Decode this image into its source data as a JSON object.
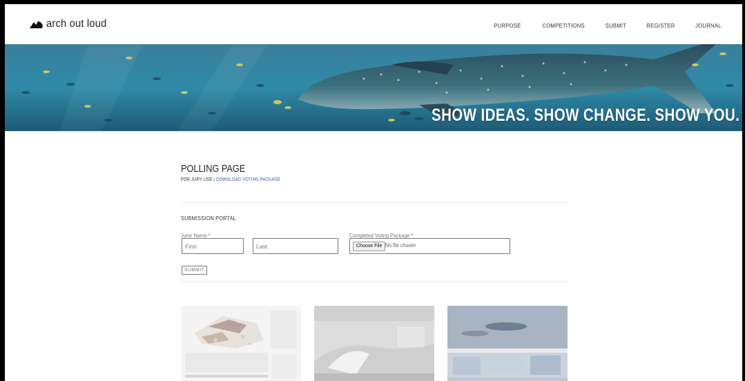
{
  "brand": {
    "logo_text": "arch out loud",
    "logo_icon": "mountain-logo-icon"
  },
  "nav": {
    "items": [
      "PURPOSE",
      "COMPETITIONS",
      "SUBMIT",
      "REGISTER",
      "JOURNAL"
    ]
  },
  "banner": {
    "tagline": "SHOW IDEAS. SHOW CHANGE. SHOW YOU."
  },
  "page": {
    "title": "POLLING PAGE",
    "sub_prefix": "FOR JURY USE",
    "sub_separator": "|",
    "sub_link": "DOWNLOAD VOTING PACKAGE"
  },
  "form": {
    "section_title": "SUBMISSION PORTAL",
    "juror_label": "Juror Name",
    "required_mark": "*",
    "first_placeholder": "First",
    "last_placeholder": "Last",
    "package_label": "Completed Voting Package",
    "choose_file": "Choose File",
    "no_file": "No file chosen",
    "submit": "SUBMIT"
  },
  "colors": {
    "link": "#3a5dae",
    "required": "#dd3333",
    "banner": "#2c7593"
  }
}
